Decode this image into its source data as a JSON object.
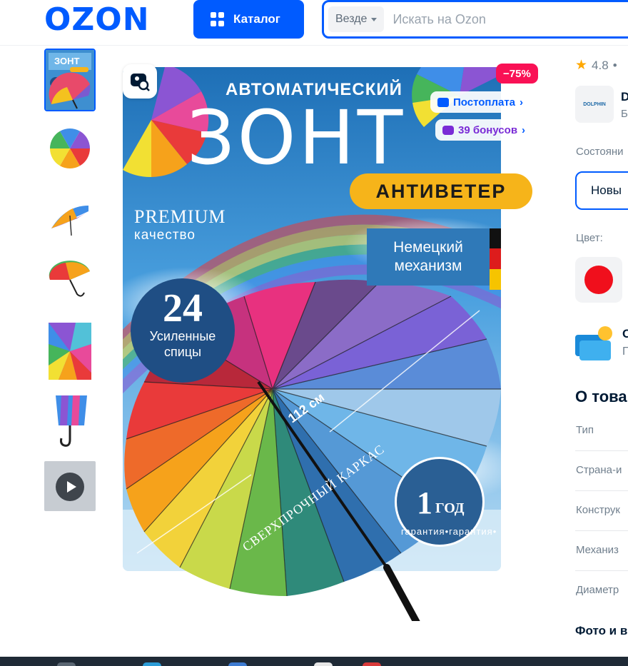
{
  "header": {
    "logo": "OZON",
    "catalog_label": "Каталог",
    "search_scope": "Везде",
    "search_placeholder": "Искать на Ozon"
  },
  "gallery": {
    "thumbnails": [
      "poster",
      "umbrella-top",
      "umbrella-side",
      "umbrella-open",
      "umbrella-closeup",
      "umbrella-folded",
      "video"
    ],
    "active_index": 0
  },
  "product_image": {
    "discount": "−75%",
    "chip_postpay": "Постоплата",
    "chip_bonus": "39 бонусов",
    "title_top": "АВТОМАТИЧЕСКИЙ",
    "title_main": "ЗОНТ",
    "badge_antiveter": "АНТИВЕТЕР",
    "premium": "PREMIUM",
    "quality": "качество",
    "mechanism_line1": "Немецкий",
    "mechanism_line2": "механизм",
    "spokes_number": "24",
    "spokes_line1": "Усиленные",
    "spokes_line2": "спицы",
    "size": "112 см",
    "frame": "СВЕРХПРОЧНЫЙ КАРКАС",
    "warranty_years": "1",
    "warranty_unit": "ГОД",
    "warranty_ring": "гарантия•гарантия•"
  },
  "product_info": {
    "rating": "4.8",
    "rating_sep": "•",
    "brand_logo": "DOLPHIN",
    "brand_name": "D",
    "brand_sub": "Б",
    "condition_label": "Состояни",
    "condition_value": "Новы",
    "color_label": "Цвет:",
    "payment_title": "О",
    "payment_sub": "Г",
    "about_title": "О това",
    "specs": [
      "Тип",
      "Страна-и",
      "Конструк",
      "Механиз",
      "Диаметр"
    ],
    "photo_heading": "Фото и в"
  },
  "colors": {
    "brand_blue": "#005bff",
    "discount": "#f91155",
    "accent_yellow": "#f6b41a",
    "swatch_red": "#f00f1c"
  }
}
